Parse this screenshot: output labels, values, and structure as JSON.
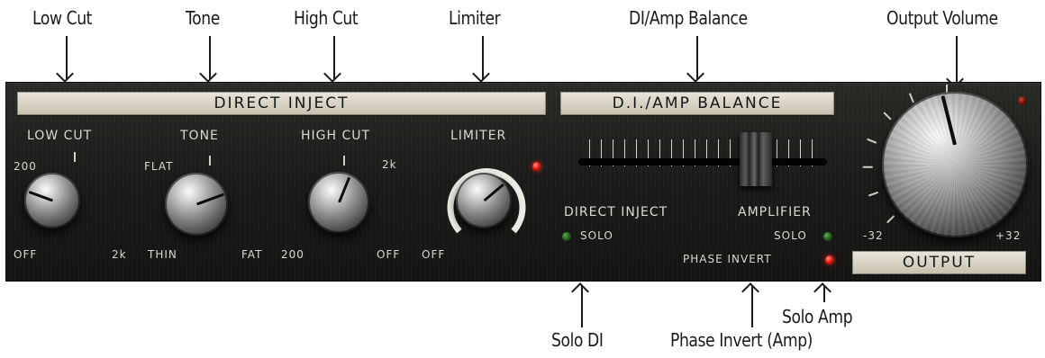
{
  "callouts": {
    "low_cut": "Low Cut",
    "tone": "Tone",
    "high_cut": "High Cut",
    "limiter": "Limiter",
    "di_amp_balance": "DI/Amp Balance",
    "output_volume": "Output Volume",
    "solo_di": "Solo DI",
    "phase_invert_amp": "Phase Invert (Amp)",
    "solo_amp": "Solo Amp"
  },
  "plates": {
    "direct_inject": "DIRECT INJECT",
    "di_amp_balance": "D.I./AMP BALANCE",
    "output": "OUTPUT"
  },
  "knobs": {
    "low_cut": {
      "label": "LOW CUT",
      "min_label": "OFF",
      "max_label": "2k",
      "mid_label": "200"
    },
    "tone": {
      "label": "TONE",
      "min_label": "THIN",
      "max_label": "FAT",
      "mid_label": "FLAT"
    },
    "high_cut": {
      "label": "HIGH CUT",
      "min_label": "200",
      "max_label": "OFF",
      "mid_label": "2k"
    },
    "limiter": {
      "label": "LIMITER",
      "min_label": "OFF"
    },
    "output": {
      "min_label": "-32",
      "max_label": "+32"
    }
  },
  "balance": {
    "left_label": "DIRECT INJECT",
    "right_label": "AMPLIFIER",
    "solo_di_label": "SOLO",
    "solo_amp_label": "SOLO",
    "phase_invert_label": "PHASE INVERT"
  },
  "leds": {
    "limiter": "on",
    "solo_di": "off",
    "solo_amp": "off",
    "phase_invert": "on",
    "output_clip": "dim"
  }
}
